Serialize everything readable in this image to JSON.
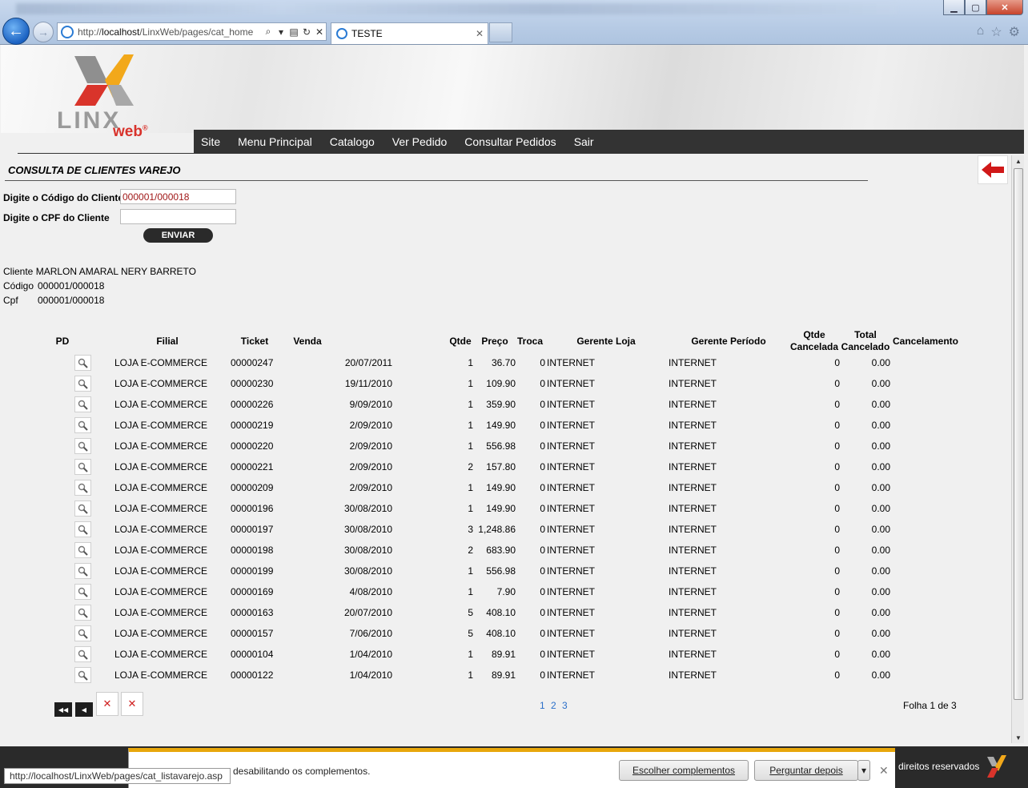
{
  "browser": {
    "address_plain": "http://",
    "address_host": "localhost",
    "address_path": "/LinxWeb/pages/cat_home",
    "tab_title": "TESTE",
    "status_url": "http://localhost/LinxWeb/pages/cat_listavarejo.asp"
  },
  "logo": {
    "text": "LINX",
    "sub": "web"
  },
  "menu": [
    "Site",
    "Menu Principal",
    "Catalogo",
    "Ver Pedido",
    "Consultar Pedidos",
    "Sair"
  ],
  "page_title": "CONSULTA DE CLIENTES VAREJO",
  "form": {
    "codigo_label": "Digite o Código do Cliente",
    "codigo_value": "000001/000018",
    "cpf_label": "Digite o CPF do Cliente",
    "cpf_value": "",
    "submit_label": "ENVIAR"
  },
  "client": {
    "cliente_label": "Cliente",
    "cliente_value": "MARLON AMARAL NERY BARRETO",
    "codigo_label": "Código",
    "codigo_value": "000001/000018",
    "cpf_label": "Cpf",
    "cpf_value": "000001/000018"
  },
  "table": {
    "headers": {
      "pd": "PD",
      "filial": "Filial",
      "ticket": "Ticket",
      "venda": "Venda",
      "qtde": "Qtde",
      "preco": "Preço",
      "troca": "Troca",
      "gerente_loja": "Gerente Loja",
      "gerente_periodo": "Gerente Período",
      "qtde_cancelada_1": "Qtde",
      "qtde_cancelada_2": "Cancelada",
      "total_cancelado_1": "Total",
      "total_cancelado_2": "Cancelado",
      "cancelamento": "Cancelamento"
    },
    "rows": [
      {
        "filial": "LOJA E-COMMERCE",
        "ticket": "00000247",
        "data": "20/07/2011",
        "qtde": "1",
        "preco": "36.70",
        "troca": "0",
        "gerente_loja": "INTERNET",
        "gerente_periodo": "INTERNET",
        "qtde_cancelada": "0",
        "total_cancelado": "0.00"
      },
      {
        "filial": "LOJA E-COMMERCE",
        "ticket": "00000230",
        "data": "19/11/2010",
        "qtde": "1",
        "preco": "109.90",
        "troca": "0",
        "gerente_loja": "INTERNET",
        "gerente_periodo": "INTERNET",
        "qtde_cancelada": "0",
        "total_cancelado": "0.00"
      },
      {
        "filial": "LOJA E-COMMERCE",
        "ticket": "00000226",
        "data": "9/09/2010",
        "qtde": "1",
        "preco": "359.90",
        "troca": "0",
        "gerente_loja": "INTERNET",
        "gerente_periodo": "INTERNET",
        "qtde_cancelada": "0",
        "total_cancelado": "0.00"
      },
      {
        "filial": "LOJA E-COMMERCE",
        "ticket": "00000219",
        "data": "2/09/2010",
        "qtde": "1",
        "preco": "149.90",
        "troca": "0",
        "gerente_loja": "INTERNET",
        "gerente_periodo": "INTERNET",
        "qtde_cancelada": "0",
        "total_cancelado": "0.00"
      },
      {
        "filial": "LOJA E-COMMERCE",
        "ticket": "00000220",
        "data": "2/09/2010",
        "qtde": "1",
        "preco": "556.98",
        "troca": "0",
        "gerente_loja": "INTERNET",
        "gerente_periodo": "INTERNET",
        "qtde_cancelada": "0",
        "total_cancelado": "0.00"
      },
      {
        "filial": "LOJA E-COMMERCE",
        "ticket": "00000221",
        "data": "2/09/2010",
        "qtde": "2",
        "preco": "157.80",
        "troca": "0",
        "gerente_loja": "INTERNET",
        "gerente_periodo": "INTERNET",
        "qtde_cancelada": "0",
        "total_cancelado": "0.00"
      },
      {
        "filial": "LOJA E-COMMERCE",
        "ticket": "00000209",
        "data": "2/09/2010",
        "qtde": "1",
        "preco": "149.90",
        "troca": "0",
        "gerente_loja": "INTERNET",
        "gerente_periodo": "INTERNET",
        "qtde_cancelada": "0",
        "total_cancelado": "0.00"
      },
      {
        "filial": "LOJA E-COMMERCE",
        "ticket": "00000196",
        "data": "30/08/2010",
        "qtde": "1",
        "preco": "149.90",
        "troca": "0",
        "gerente_loja": "INTERNET",
        "gerente_periodo": "INTERNET",
        "qtde_cancelada": "0",
        "total_cancelado": "0.00"
      },
      {
        "filial": "LOJA E-COMMERCE",
        "ticket": "00000197",
        "data": "30/08/2010",
        "qtde": "3",
        "preco": "1,248.86",
        "troca": "0",
        "gerente_loja": "INTERNET",
        "gerente_periodo": "INTERNET",
        "qtde_cancelada": "0",
        "total_cancelado": "0.00"
      },
      {
        "filial": "LOJA E-COMMERCE",
        "ticket": "00000198",
        "data": "30/08/2010",
        "qtde": "2",
        "preco": "683.90",
        "troca": "0",
        "gerente_loja": "INTERNET",
        "gerente_periodo": "INTERNET",
        "qtde_cancelada": "0",
        "total_cancelado": "0.00"
      },
      {
        "filial": "LOJA E-COMMERCE",
        "ticket": "00000199",
        "data": "30/08/2010",
        "qtde": "1",
        "preco": "556.98",
        "troca": "0",
        "gerente_loja": "INTERNET",
        "gerente_periodo": "INTERNET",
        "qtde_cancelada": "0",
        "total_cancelado": "0.00"
      },
      {
        "filial": "LOJA E-COMMERCE",
        "ticket": "00000169",
        "data": "4/08/2010",
        "qtde": "1",
        "preco": "7.90",
        "troca": "0",
        "gerente_loja": "INTERNET",
        "gerente_periodo": "INTERNET",
        "qtde_cancelada": "0",
        "total_cancelado": "0.00"
      },
      {
        "filial": "LOJA E-COMMERCE",
        "ticket": "00000163",
        "data": "20/07/2010",
        "qtde": "5",
        "preco": "408.10",
        "troca": "0",
        "gerente_loja": "INTERNET",
        "gerente_periodo": "INTERNET",
        "qtde_cancelada": "0",
        "total_cancelado": "0.00"
      },
      {
        "filial": "LOJA E-COMMERCE",
        "ticket": "00000157",
        "data": "7/06/2010",
        "qtde": "5",
        "preco": "408.10",
        "troca": "0",
        "gerente_loja": "INTERNET",
        "gerente_periodo": "INTERNET",
        "qtde_cancelada": "0",
        "total_cancelado": "0.00"
      },
      {
        "filial": "LOJA E-COMMERCE",
        "ticket": "00000104",
        "data": "1/04/2010",
        "qtde": "1",
        "preco": "89.91",
        "troca": "0",
        "gerente_loja": "INTERNET",
        "gerente_periodo": "INTERNET",
        "qtde_cancelada": "0",
        "total_cancelado": "0.00"
      },
      {
        "filial": "LOJA E-COMMERCE",
        "ticket": "00000122",
        "data": "1/04/2010",
        "qtde": "1",
        "preco": "89.91",
        "troca": "0",
        "gerente_loja": "INTERNET",
        "gerente_periodo": "INTERNET",
        "qtde_cancelada": "0",
        "total_cancelado": "0.00"
      }
    ]
  },
  "pager": {
    "pages": "1 2 3",
    "folha": "Folha 1 de 3"
  },
  "footer": {
    "rights": "direitos reservados"
  },
  "notification": {
    "message": "desabilitando os complementos.",
    "button_choose": "Escolher complementos",
    "button_later": "Perguntar depois"
  },
  "colors": {
    "menu_bg": "#333333",
    "accent": "#e8a70c",
    "input_text": "#a01818",
    "link": "#2a6fc9"
  }
}
